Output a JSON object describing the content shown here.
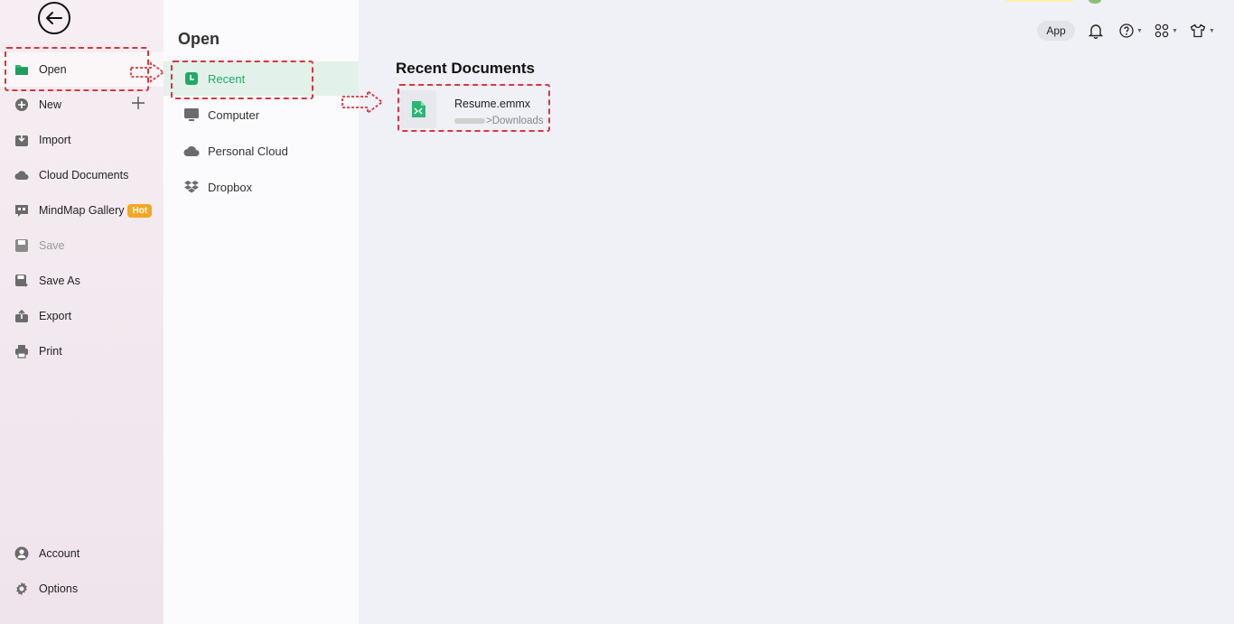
{
  "sidebar": {
    "items": [
      {
        "label": "Open",
        "icon": "folder-icon"
      },
      {
        "label": "New",
        "icon": "plus-circle-icon"
      },
      {
        "label": "Import",
        "icon": "import-icon"
      },
      {
        "label": "Cloud Documents",
        "icon": "cloud-icon"
      },
      {
        "label": "MindMap Gallery",
        "icon": "gallery-icon",
        "badge": "Hot"
      },
      {
        "label": "Save",
        "icon": "save-icon"
      },
      {
        "label": "Save As",
        "icon": "save-as-icon"
      },
      {
        "label": "Export",
        "icon": "export-icon"
      },
      {
        "label": "Print",
        "icon": "print-icon"
      }
    ],
    "bottom": [
      {
        "label": "Account",
        "icon": "account-icon"
      },
      {
        "label": "Options",
        "icon": "gear-icon"
      }
    ]
  },
  "open_panel": {
    "title": "Open",
    "items": [
      {
        "label": "Recent",
        "icon": "recent-icon"
      },
      {
        "label": "Computer",
        "icon": "monitor-icon"
      },
      {
        "label": "Personal Cloud",
        "icon": "cloud-icon"
      },
      {
        "label": "Dropbox",
        "icon": "dropbox-icon"
      }
    ]
  },
  "toolbar": {
    "app_label": "App"
  },
  "main": {
    "title": "Recent Documents",
    "documents": [
      {
        "name": "Resume.emmx",
        "path_suffix": ">Downloads"
      }
    ]
  },
  "colors": {
    "accent": "#1faa6a",
    "hot_badge": "#f5a623",
    "annotation": "#e0333b"
  }
}
